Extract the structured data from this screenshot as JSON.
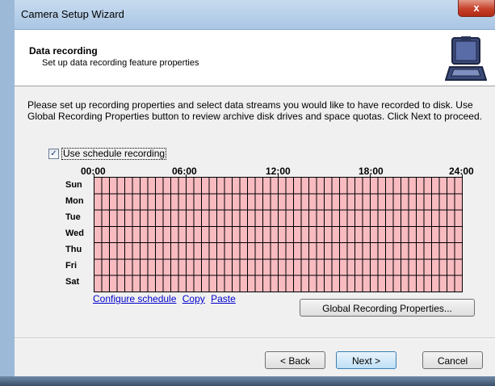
{
  "window": {
    "title": "Camera Setup Wizard",
    "close_glyph": "x"
  },
  "header": {
    "title": "Data recording",
    "subtitle": "Set up data recording feature properties",
    "icon": "laptop-camera-icon"
  },
  "description": "Please set up recording properties and select data streams you would like to have recorded to disk. Use Global Recording Properties button to review archive disk drives and space quotas. Click Next to proceed.",
  "schedule": {
    "checkbox_label": "Use schedule recording",
    "checked": true,
    "checkmark": "✓",
    "times": [
      "00:00",
      "06:00",
      "12:00",
      "18:00",
      "24:00"
    ],
    "days": [
      "Sun",
      "Mon",
      "Tue",
      "Wed",
      "Thu",
      "Fri",
      "Sat"
    ],
    "grid_color": "#f8bbc0"
  },
  "links": {
    "configure": "Configure schedule",
    "copy": "Copy",
    "paste": "Paste"
  },
  "buttons": {
    "global_props": "Global Recording Properties...",
    "back": "< Back",
    "next": "Next >",
    "cancel": "Cancel"
  }
}
